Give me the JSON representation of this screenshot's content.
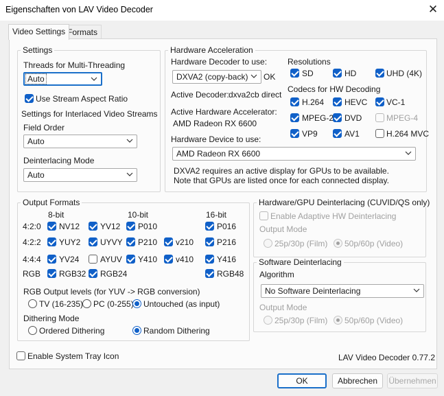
{
  "window": {
    "title": "Eigenschaften von LAV Video Decoder",
    "close_glyph": "✕"
  },
  "tabs": [
    {
      "label": "Video Settings",
      "active": true
    },
    {
      "label": "Formats",
      "active": false
    }
  ],
  "settings": {
    "group_title": "Settings",
    "threads_label": "Threads for Multi-Threading",
    "threads_value": "Auto",
    "stream_aspect_label": "Use Stream Aspect Ratio",
    "stream_aspect_checked": "indeterminate",
    "interlaced_heading": "Settings for Interlaced Video Streams",
    "field_order_label": "Field Order",
    "field_order_value": "Auto",
    "deinterlacing_mode_label": "Deinterlacing Mode",
    "deinterlacing_mode_value": "Auto"
  },
  "hw_accel": {
    "group_title": "Hardware Acceleration",
    "decoder_label": "Hardware Decoder to use:",
    "decoder_value": "DXVA2 (copy-back)",
    "decoder_status": "OK",
    "active_decoder_label": "Active Decoder:",
    "active_decoder_value": "dxva2cb direct",
    "active_accel_label": "Active Hardware Accelerator:",
    "active_accel_value": "AMD Radeon RX 6600",
    "device_label": "Hardware Device to use:",
    "device_value": "AMD Radeon RX 6600",
    "note_line1": "DXVA2 requires an active display for GPUs to be available.",
    "note_line2": "Note that GPUs are listed once for each connected display.",
    "resolutions_label": "Resolutions",
    "resolutions": [
      {
        "label": "SD",
        "checked": true
      },
      {
        "label": "HD",
        "checked": true
      },
      {
        "label": "UHD (4K)",
        "checked": true
      }
    ],
    "codecs_label": "Codecs for HW Decoding",
    "codecs": [
      {
        "label": "H.264",
        "state": "on"
      },
      {
        "label": "HEVC",
        "state": "on"
      },
      {
        "label": "VC-1",
        "state": "on"
      },
      {
        "label": "MPEG-2",
        "state": "on"
      },
      {
        "label": "DVD",
        "state": "on"
      },
      {
        "label": "MPEG-4",
        "state": "disabled"
      },
      {
        "label": "VP9",
        "state": "on"
      },
      {
        "label": "AV1",
        "state": "on"
      },
      {
        "label": "H.264 MVC",
        "state": "off"
      }
    ]
  },
  "output": {
    "group_title": "Output Formats",
    "col_headers": [
      "8-bit",
      "10-bit",
      "16-bit"
    ],
    "row_labels": [
      "4:2:0",
      "4:2:2",
      "4:4:4",
      "RGB"
    ],
    "formats": [
      {
        "label": "NV12",
        "state": "on"
      },
      {
        "label": "YV12",
        "state": "on"
      },
      {
        "label": "P010",
        "state": "on"
      },
      {
        "label": "P016",
        "state": "on"
      },
      {
        "label": "YUY2",
        "state": "on"
      },
      {
        "label": "UYVY",
        "state": "on"
      },
      {
        "label": "P210",
        "state": "on"
      },
      {
        "label": "v210",
        "state": "on"
      },
      {
        "label": "P216",
        "state": "on"
      },
      {
        "label": "YV24",
        "state": "on"
      },
      {
        "label": "AYUV",
        "state": "off"
      },
      {
        "label": "Y410",
        "state": "on"
      },
      {
        "label": "v410",
        "state": "on"
      },
      {
        "label": "Y416",
        "state": "on"
      },
      {
        "label": "RGB32",
        "state": "on"
      },
      {
        "label": "RGB24",
        "state": "on"
      },
      {
        "label": "RGB48",
        "state": "on"
      }
    ],
    "rgb_levels_label": "RGB Output levels (for YUV -> RGB conversion)",
    "rgb_levels": [
      {
        "label": "TV (16-235)",
        "selected": false
      },
      {
        "label": "PC (0-255)",
        "selected": false
      },
      {
        "label": "Untouched (as input)",
        "selected": true
      }
    ],
    "dithering_label": "Dithering Mode",
    "dithering": [
      {
        "label": "Ordered Dithering",
        "selected": false
      },
      {
        "label": "Random Dithering",
        "selected": true
      }
    ]
  },
  "hw_deint": {
    "group_title": "Hardware/GPU Deinterlacing (CUVID/QS only)",
    "adaptive_label": "Enable Adaptive HW Deinterlacing",
    "output_mode_label": "Output Mode",
    "modes": [
      {
        "label": "25p/30p (Film)",
        "selected": false
      },
      {
        "label": "50p/60p (Video)",
        "selected": true
      }
    ]
  },
  "sw_deint": {
    "group_title": "Software Deinterlacing",
    "algorithm_label": "Algorithm",
    "algorithm_value": "No Software Deinterlacing",
    "output_mode_label": "Output Mode",
    "modes": [
      {
        "label": "25p/30p (Film)",
        "selected": false
      },
      {
        "label": "50p/60p (Video)",
        "selected": true
      }
    ]
  },
  "tray_icon_label": "Enable System Tray Icon",
  "version": "LAV Video Decoder 0.77.2",
  "buttons": {
    "ok": "OK",
    "cancel": "Abbrechen",
    "apply": "Übernehmen"
  },
  "colors": {
    "accent": "#1060c8",
    "panel": "#fbfbfb",
    "dialog": "#f0f0f0"
  }
}
